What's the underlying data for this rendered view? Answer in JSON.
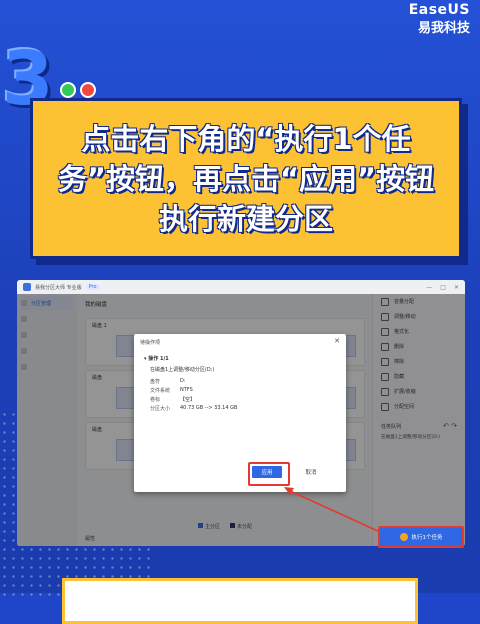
{
  "brand": {
    "en": "EaseUS",
    "zh": "易我科技"
  },
  "step_number": "3",
  "banner_text": "点击右下角的“执行1个任务”按钮，再点击“应用”按钮执行新建分区",
  "app": {
    "title": "易我分区大师 专业版",
    "badge": "Pro",
    "sidebar": [
      {
        "label": "分区管理",
        "active": true
      },
      {
        "label": "",
        "active": false
      },
      {
        "label": "",
        "active": false
      },
      {
        "label": "",
        "active": false
      },
      {
        "label": "",
        "active": false
      }
    ],
    "main_heading": "我的磁盘",
    "disks": [
      {
        "label": "磁盘 1"
      },
      {
        "label": "磁盘"
      },
      {
        "label": "磁盘"
      }
    ],
    "legend": [
      "主分区",
      "未分配"
    ],
    "properties_label": "属性",
    "operations": [
      "容量分配",
      "调整/移动",
      "格式化",
      "删除",
      "擦除",
      "隐藏",
      "扩展/收缩",
      "分配空间"
    ],
    "task_queue": {
      "title": "任务队列",
      "item": "在磁盘1上调整/移动分区(D:)"
    },
    "execute_button": "执行1个任务"
  },
  "dialog": {
    "title": "待操作项",
    "op_header": "操作 1/1",
    "desc": "在磁盘1上调整/移动分区(D:)",
    "rows": [
      {
        "k": "盘符",
        "v": "D:"
      },
      {
        "k": "文件系统",
        "v": "NTFS"
      },
      {
        "k": "卷标",
        "v": "【空】"
      },
      {
        "k": "分区大小",
        "v": "40.73 GB --> 33.14 GB"
      }
    ],
    "apply": "应用",
    "cancel": "取消"
  },
  "colors": {
    "accent": "#2f68e4",
    "highlight": "#e23a2f",
    "banner": "#fdc233"
  }
}
